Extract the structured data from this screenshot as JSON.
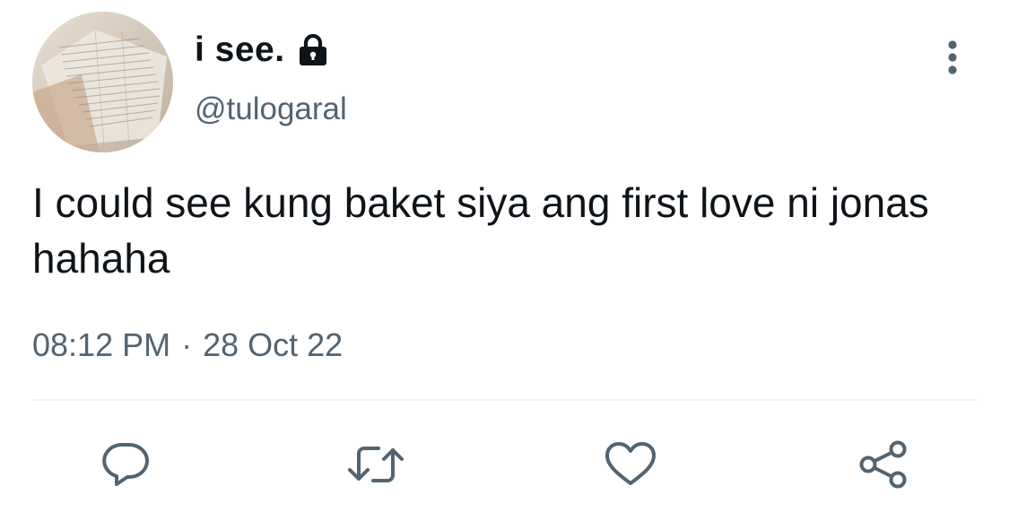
{
  "tweet": {
    "author": {
      "display_name": "i see.",
      "handle": "@tulogaral",
      "protected": true,
      "avatar_icon": "avatar-photo-notes"
    },
    "text": "I could see kung baket siya ang first love ni jonas hahaha",
    "time": "08:12 PM",
    "separator": "·",
    "date": "28 Oct 22"
  },
  "actions": {
    "reply_icon": "reply-icon",
    "retweet_icon": "retweet-icon",
    "like_icon": "heart-icon",
    "share_icon": "share-icon"
  },
  "colors": {
    "text": "#0f1419",
    "secondary": "#536471",
    "divider": "#eff3f4"
  }
}
